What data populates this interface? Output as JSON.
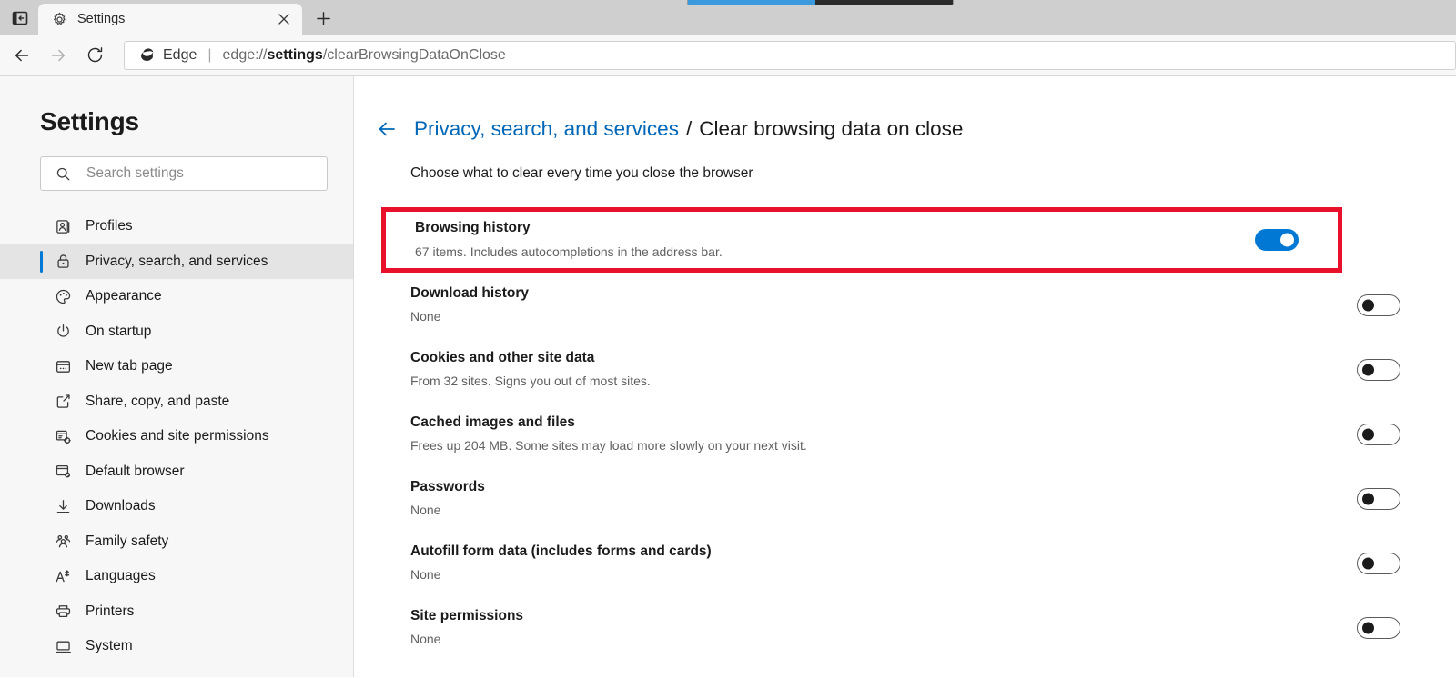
{
  "browser": {
    "tab": {
      "title": "Settings",
      "favicon_icon": "gear-icon",
      "close_icon": "close-icon"
    },
    "new_tab_label": "+",
    "tab_left_icon": "tab-actions-icon",
    "toolbar": {
      "back_icon": "arrow-left-icon",
      "forward_icon": "arrow-right-icon",
      "refresh_icon": "refresh-icon",
      "star_icon": "favorite-star-icon"
    },
    "omnibox": {
      "brand": "Edge",
      "brand_icon": "edge-logo-icon",
      "separator": "|",
      "url_prefix": "edge://",
      "url_bold": "settings",
      "url_suffix": "/clearBrowsingDataOnClose"
    },
    "clipped_progress": {
      "percent": 48
    }
  },
  "sidebar": {
    "heading": "Settings",
    "search": {
      "placeholder": "Search settings",
      "value": "",
      "icon": "search-icon"
    },
    "items": [
      {
        "label": "Profiles",
        "icon": "profiles-icon",
        "active": false
      },
      {
        "label": "Privacy, search, and services",
        "icon": "lock-icon",
        "active": true
      },
      {
        "label": "Appearance",
        "icon": "palette-icon",
        "active": false
      },
      {
        "label": "On startup",
        "icon": "power-icon",
        "active": false
      },
      {
        "label": "New tab page",
        "icon": "new-tab-page-icon",
        "active": false
      },
      {
        "label": "Share, copy, and paste",
        "icon": "share-icon",
        "active": false
      },
      {
        "label": "Cookies and site permissions",
        "icon": "cookies-icon",
        "active": false
      },
      {
        "label": "Default browser",
        "icon": "default-browser-icon",
        "active": false
      },
      {
        "label": "Downloads",
        "icon": "download-icon",
        "active": false
      },
      {
        "label": "Family safety",
        "icon": "family-icon",
        "active": false
      },
      {
        "label": "Languages",
        "icon": "languages-icon",
        "active": false
      },
      {
        "label": "Printers",
        "icon": "printer-icon",
        "active": false
      },
      {
        "label": "System",
        "icon": "system-icon",
        "active": false
      }
    ]
  },
  "main": {
    "back_icon": "arrow-left-icon",
    "breadcrumb_parent": "Privacy, search, and services",
    "breadcrumb_separator": "/",
    "breadcrumb_current": "Clear browsing data on close",
    "subtitle": "Choose what to clear every time you close the browser",
    "highlight_color": "#e8102a",
    "accent_color": "#0078d4",
    "link_color": "#0067b8",
    "settings": [
      {
        "title": "Browsing history",
        "description": "67 items. Includes autocompletions in the address bar.",
        "toggle": "on",
        "highlighted": true
      },
      {
        "title": "Download history",
        "description": "None",
        "toggle": "off",
        "highlighted": false
      },
      {
        "title": "Cookies and other site data",
        "description": "From 32 sites. Signs you out of most sites.",
        "toggle": "off",
        "highlighted": false
      },
      {
        "title": "Cached images and files",
        "description": "Frees up 204 MB. Some sites may load more slowly on your next visit.",
        "toggle": "off",
        "highlighted": false
      },
      {
        "title": "Passwords",
        "description": "None",
        "toggle": "off",
        "highlighted": false
      },
      {
        "title": "Autofill form data (includes forms and cards)",
        "description": "None",
        "toggle": "off",
        "highlighted": false
      },
      {
        "title": "Site permissions",
        "description": "None",
        "toggle": "off",
        "highlighted": false
      }
    ]
  }
}
